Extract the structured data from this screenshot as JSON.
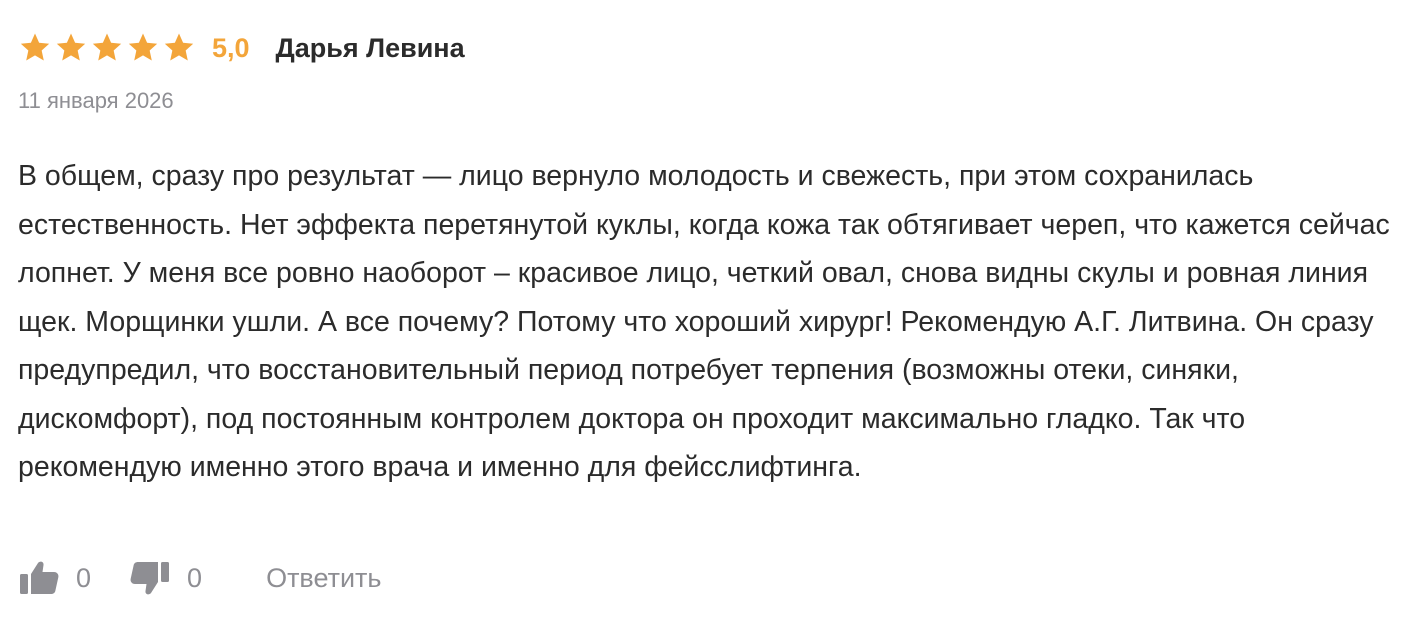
{
  "review": {
    "rating": 5,
    "rating_label": "5,0",
    "author": "Дарья Левина",
    "date": "11 января 2026",
    "text": "В общем, сразу про результат — лицо вернуло молодость и свежесть, при этом сохранилась естественность. Нет эффекта перетянутой куклы, когда кожа так обтягивает череп, что кажется сейчас лопнет. У меня все ровно наоборот – красивое лицо, четкий овал, снова видны скулы и ровная линия щек. Морщинки ушли. А все почему? Потому что хороший хирург! Рекомендую А.Г. Литвина. Он сразу предупредил, что восстановительный период потребует терпения (возможны отеки, синяки, дискомфорт), под постоянным контролем доктора он проходит максимально гладко. Так что рекомендую именно этого врача и именно для фейсслифтинга."
  },
  "actions": {
    "like_icon": "thumbs-up-icon",
    "like_count": "0",
    "dislike_icon": "thumbs-down-icon",
    "dislike_count": "0",
    "reply_label": "Ответить"
  },
  "colors": {
    "star": "#f3a53a",
    "rating": "#f3a53a",
    "text": "#2b2b2b",
    "muted": "#8e8e93",
    "icon": "#8e8e93"
  }
}
